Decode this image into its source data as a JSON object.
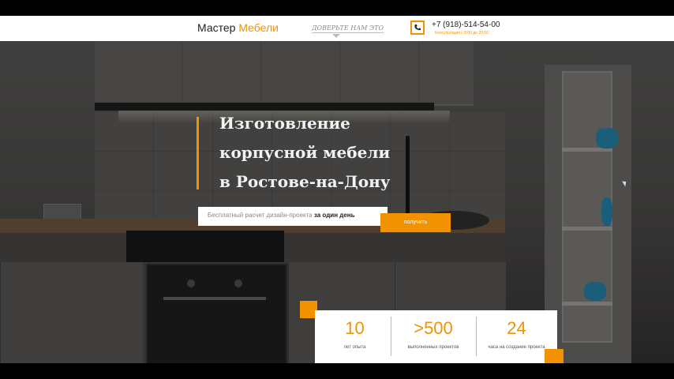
{
  "header": {
    "logo_part1": "Мастер",
    "logo_part2": "Мебели",
    "tagline": "ДОВЕРЬТЕ НАМ ЭТО",
    "phone": "+7 (918)-514-54-00",
    "hours": "Консультация с 8:00 до 20:00",
    "accent_color": "#f39200"
  },
  "hero": {
    "title_lines": [
      "Изготовление",
      "корпусной мебели",
      "в Ростове-на-Дону"
    ],
    "offer_text": "Бесплатный расчет дизайн-проекта",
    "offer_bold": "за один день",
    "button_label": "получить"
  },
  "stats": [
    {
      "value": "10",
      "label": "лет опыта"
    },
    {
      "value": ">500",
      "label": "выполненных проектов"
    },
    {
      "value": "24",
      "label": "часа на создание проекта"
    }
  ],
  "icons": {
    "phone": "phone-icon"
  }
}
